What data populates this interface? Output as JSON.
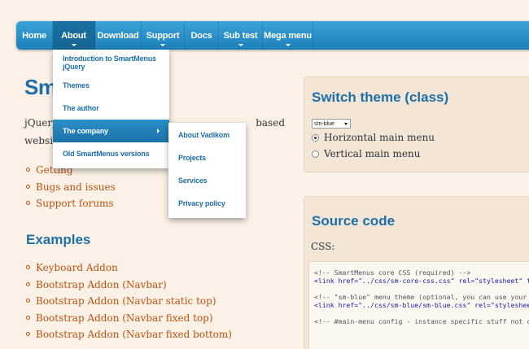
{
  "nav": {
    "items": [
      {
        "label": "Home",
        "has_sub": false,
        "active": false,
        "width": 45
      },
      {
        "label": "About",
        "has_sub": true,
        "active": true,
        "width": 52
      },
      {
        "label": "Download",
        "has_sub": false,
        "active": false,
        "width": 57
      },
      {
        "label": "Support",
        "has_sub": true,
        "active": false,
        "width": 53
      },
      {
        "label": "Docs",
        "has_sub": false,
        "active": false,
        "width": 42
      },
      {
        "label": "Sub test",
        "has_sub": true,
        "active": false,
        "width": 54
      },
      {
        "label": "Mega menu",
        "has_sub": true,
        "active": false,
        "width": 62
      }
    ]
  },
  "about_menu": {
    "items": [
      {
        "label": "Introduction to SmartMenus jQuery",
        "highlight": false,
        "has_sub": false
      },
      {
        "label": "Themes",
        "highlight": false,
        "has_sub": false
      },
      {
        "label": "The author",
        "highlight": false,
        "has_sub": false
      },
      {
        "label": "The company",
        "highlight": true,
        "has_sub": true
      },
      {
        "label": "Old SmartMenus versions",
        "highlight": false,
        "has_sub": false
      }
    ]
  },
  "company_menu": {
    "items": [
      {
        "label": "About Vadikom"
      },
      {
        "label": "Projects"
      },
      {
        "label": "Services"
      },
      {
        "label": "Privacy policy"
      }
    ]
  },
  "main": {
    "title_partial": "Sma",
    "intro_start_1": "jQuery",
    "intro_start_2": "website",
    "intro_end": "based",
    "links": [
      "Getting",
      "Bugs and issues",
      "Support forums"
    ],
    "examples_heading": "Examples",
    "examples": [
      "Keyboard Addon",
      "Bootstrap Addon (Navbar)",
      "Bootstrap Addon (Navbar static top)",
      "Bootstrap Addon (Navbar fixed top)",
      "Bootstrap Addon (Navbar fixed bottom)"
    ]
  },
  "switch_theme": {
    "title": "Switch theme (class)",
    "select_value": "sm-blue",
    "options": [
      {
        "label": "Horizontal main menu",
        "checked": true
      },
      {
        "label": "Vertical main menu",
        "checked": false
      }
    ]
  },
  "source_code": {
    "title": "Source code",
    "css_label": "CSS:",
    "lines": [
      "<!-- SmartMenus core CSS (required) -->",
      "<link href=\"../css/sm-core-css.css\" rel=\"stylesheet\" typ",
      "",
      "<!-- \"sm-blue\" menu theme (optional, you can use your ow",
      "<link href=\"../css/sm-blue/sm-blue.css\" rel=\"stylesheet\" ",
      "",
      "<!-- #main-menu config - instance specific stuff not cov"
    ]
  }
}
